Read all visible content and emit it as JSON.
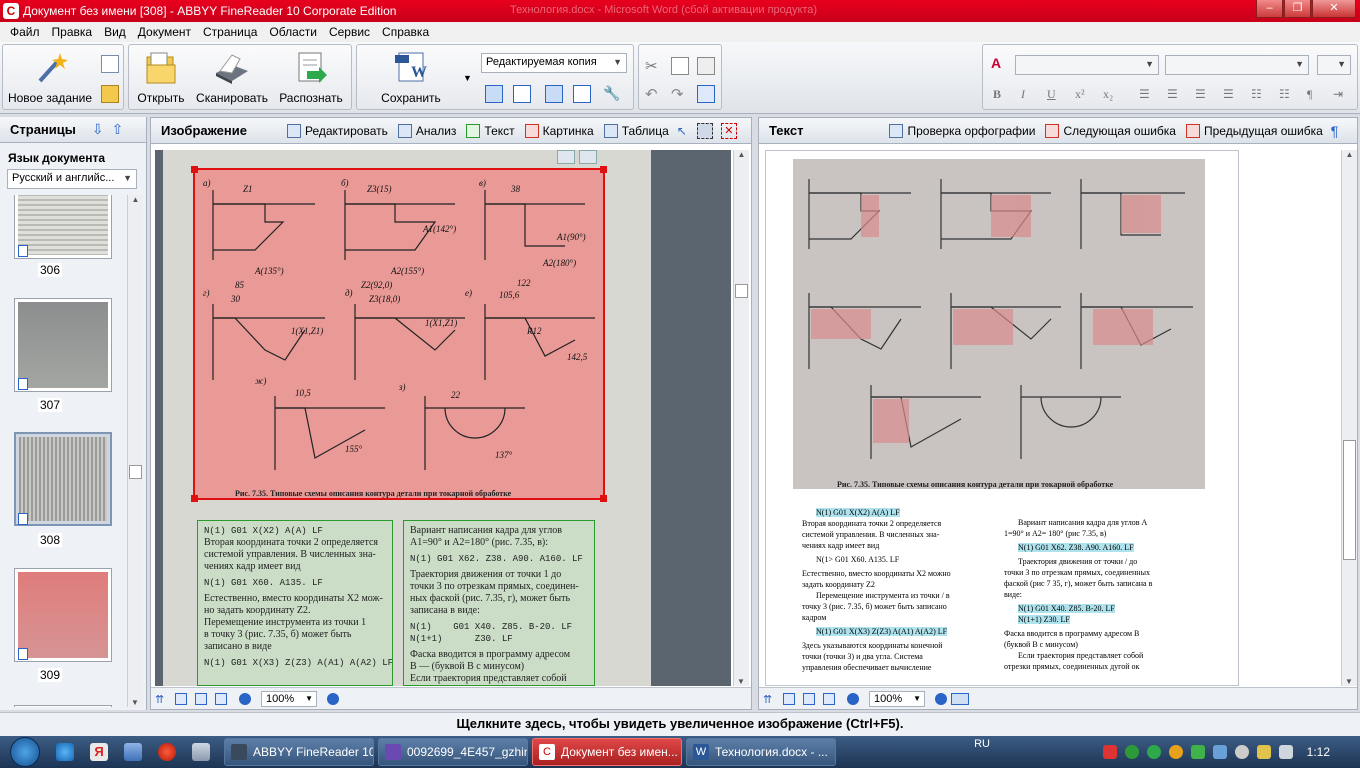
{
  "window": {
    "title": "Документ без имени [308] - ABBYY FineReader 10 Corporate Edition",
    "background_title": "Технология.docx - Microsoft Word (сбой активации продукта)"
  },
  "menu": [
    "Файл",
    "Правка",
    "Вид",
    "Документ",
    "Страница",
    "Области",
    "Сервис",
    "Справка"
  ],
  "toolbar": {
    "new_task": "Новое задание",
    "open": "Открыть",
    "scan": "Сканировать",
    "recognize": "Распознать",
    "save": "Сохранить",
    "save_format": "Редактируемая копия"
  },
  "pages_pane": {
    "title": "Страницы",
    "language_label": "Язык документа",
    "language_value": "Русский и английс...",
    "pages": [
      "306",
      "307",
      "308",
      "309"
    ]
  },
  "image_pane": {
    "title": "Изображение",
    "buttons": [
      "Редактировать",
      "Анализ",
      "Текст",
      "Картинка",
      "Таблица"
    ],
    "zoom": "100%",
    "caption": "Рис. 7.35. Типовые схемы описания контура детали при токарной обработке",
    "left_block": [
      "N(1) G01 X(X2) A(A) LF",
      "Вторая координата точки 2 определяется",
      "системой управления. В численных зна-",
      "чениях кадр имеет вид",
      "N(1) G01 X60. A135. LF",
      "Естественно, вместо координаты X2 мож-",
      "но задать координату Z2.",
      "Перемещение инструмента из точки 1",
      "в точку 3 (рис. 7.35, б) может быть",
      "записано в виде",
      "N(1) G01 X(X3) Z(Z3) A(A1) A(A2) LF"
    ],
    "right_block": [
      "Вариант написания кадра для углов",
      "A1=90° и A2=180° (рис. 7.35, в):",
      "N(1) G01 X62. Z38. A90. A160. LF",
      "Траектория движения от точки 1 до",
      "точки 3 по отрезкам прямых, соединен-",
      "ных фаской (рис. 7.35, г), может быть",
      "записана в виде:",
      "N(1)    G01 X40. Z85. B-20. LF",
      "N(1+1)      Z30. LF",
      "Фаска вводится в программу адресом",
      "B — (буквой B с минусом)",
      "Если траектория представляет собой"
    ]
  },
  "text_pane": {
    "title": "Текст",
    "buttons": [
      "Проверка орфографии",
      "Следующая ошибка",
      "Предыдущая ошибка"
    ],
    "zoom": "100%",
    "caption": "Рис. 7.35. Типовые схемы описания контура детали при токарной обработке",
    "left_col": [
      "N(1) G01 X(X2) A(A) LF",
      "Вторая координата точки 2 определяется",
      "системой управления. В численных зна-",
      "чениях кадр имеет вид",
      "N(1> G01 X60. A135. LF",
      "Естественно, вместо координаты X2 можно",
      "задать координату Z2",
      "Перемещение инструмента из точки / в",
      "точку 3 (рис. 7.35, б) может быть записано",
      "кадром",
      "N(1) G01 X(X3) Z(Z3) A(A1) A(A2) LF",
      "Здесь указываются координаты конечной",
      "точки (точки 3) и два угла. Система",
      "управления обеспечивает вычисление"
    ],
    "right_col": [
      "Вариант написания кадра для углов A",
      "1=90° и A2= 180° (рис 7.35, в)",
      "N(1) G01 X62. Z38. A90. A160. LF",
      "Траектория движения от точки / до",
      "точки 3 по отрезкам прямых, соединенных",
      "фаской (рис 7 35, г), может быть записана в",
      "виде:",
      "N(1) G01 X40. Z85. B-20. LF",
      "N(1+1) Z30. LF",
      "Фаска вводится в программу адресом B",
      "(буквой B с минусом)",
      "Если траектория представляет собой",
      "отрезки прямых, соединенных дугой ок"
    ]
  },
  "status": "Щелкните здесь, чтобы увидеть увеличенное изображение (Ctrl+F5).",
  "taskbar": {
    "tasks": [
      "ABBYY FineReader 10",
      "0092699_4E457_gzhir...",
      "Документ без имен...",
      "Технология.docx - ..."
    ],
    "lang": "RU",
    "time": "1:12"
  },
  "diagram_labels": {
    "a": "а)",
    "b": "б)",
    "v": "в)",
    "g": "г)",
    "d": "д)",
    "e": "е)",
    "zh": "ж)",
    "z": "з)",
    "z1": "Z1",
    "z2": "Z2(92,0)",
    "z3": "Z3(15)",
    "z3b": "Z3(18,0)",
    "x1": "X1",
    "a135": "A(135°)",
    "a142": "A1(142°)",
    "a155": "A2(155°)",
    "a130": "A1(90°)",
    "a160": "A2(180°)",
    "d38": "38",
    "d85": "85",
    "d30": "30",
    "d122": "122",
    "d105": "105,6",
    "d20": "20",
    "d105b": "10,5",
    "d22": "22",
    "r12": "R12",
    "d142": "142,5",
    "d155": "155°",
    "d137": "137°",
    "x1z1": "1(X1,Z1)"
  }
}
